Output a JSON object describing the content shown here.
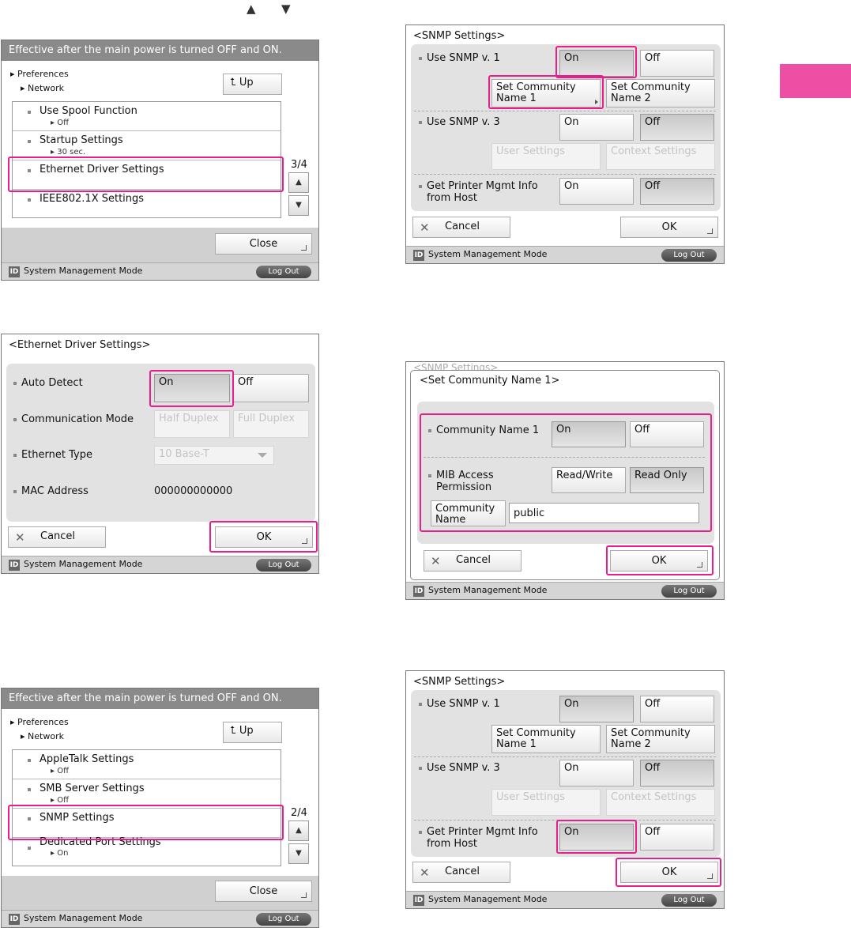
{
  "header_glyphs": {
    "up": "▲",
    "down": "▼"
  },
  "common": {
    "id_icon": "ID",
    "mode": "System Management Mode",
    "logout": "Log Out",
    "close": "Close",
    "cancel": "Cancel",
    "ok": "OK",
    "up": "Up",
    "on": "On",
    "off": "Off",
    "up_icon": "⮤"
  },
  "s1": {
    "title": "Effective after the main power is turned OFF and ON.",
    "crumb1": "Preferences",
    "crumb2": "Network",
    "page": "3/4",
    "items": [
      {
        "t": "Use Spool Function",
        "s": "Off"
      },
      {
        "t": "Startup Settings",
        "s": "30 sec."
      },
      {
        "t": "Ethernet Driver Settings",
        "s": ""
      },
      {
        "t": "IEEE802.1X Settings",
        "s": ""
      }
    ]
  },
  "s2": {
    "title": "<Ethernet Driver Settings>",
    "auto_detect": "Auto Detect",
    "comm_mode": "Communication Mode",
    "half": "Half Duplex",
    "full": "Full Duplex",
    "eth_type": "Ethernet Type",
    "eth_value": "10 Base-T",
    "mac": "MAC Address",
    "mac_value": "000000000000"
  },
  "s3": {
    "title": "Effective after the main power is turned OFF and ON.",
    "crumb1": "Preferences",
    "crumb2": "Network",
    "page": "2/4",
    "items": [
      {
        "t": "AppleTalk Settings",
        "s": "Off"
      },
      {
        "t": "SMB Server Settings",
        "s": "Off"
      },
      {
        "t": "SNMP Settings",
        "s": ""
      },
      {
        "t": "Dedicated Port Settings",
        "s": "On"
      }
    ]
  },
  "snmp": {
    "title": "<SNMP Settings>",
    "v1": "Use SNMP v. 1",
    "v3": "Use SNMP v. 3",
    "comm1": "Set Community\nName 1",
    "comm2": "Set Community\nName 2",
    "user": "User Settings",
    "context": "Context Settings",
    "printer": "Get Printer Mgmt Info\nfrom Host"
  },
  "s5": {
    "behind": "<SNMP Settings>",
    "title": "<Set Community Name 1>",
    "cn1": "Community Name 1",
    "mib": "MIB Access\nPermission",
    "rw": "Read/Write",
    "ro": "Read Only",
    "cname": "Community\nName",
    "cvalue": "public"
  },
  "colors": {
    "highlight": "#e81e8c",
    "tab": "#ee4fa4"
  }
}
